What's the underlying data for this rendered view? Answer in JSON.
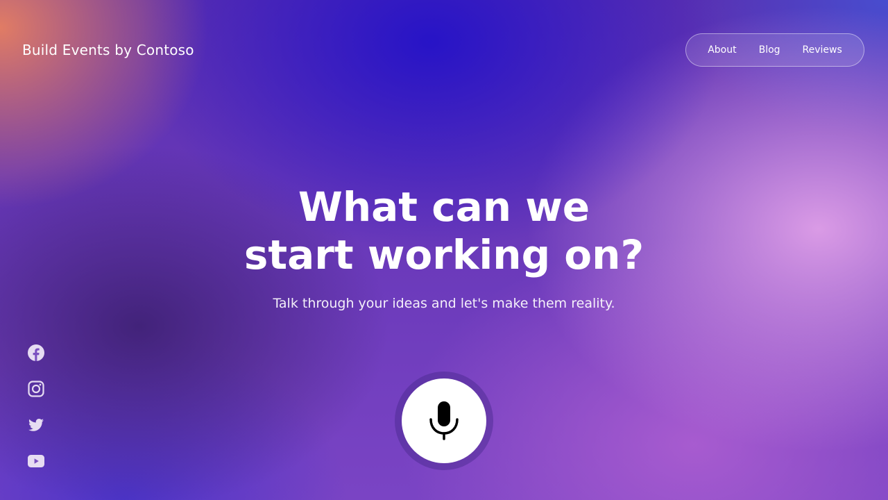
{
  "header": {
    "brand": "Build Events by Contoso"
  },
  "nav": {
    "items": [
      {
        "label": "About"
      },
      {
        "label": "Blog"
      },
      {
        "label": "Reviews"
      }
    ]
  },
  "hero": {
    "title_line1": "What can we",
    "title_line2": "start working on?",
    "subtitle": "Talk through your ideas and let's make them reality."
  },
  "social": {
    "icons": [
      "facebook-icon",
      "instagram-icon",
      "twitter-icon",
      "youtube-icon"
    ],
    "icon_color": "#e6dcf2"
  },
  "mic": {
    "icon": "microphone-icon",
    "button_color": "#ffffff",
    "icon_color": "#000000"
  },
  "colors": {
    "text": "#ffffff",
    "background_primary": "#6a3fc0",
    "background_accent_blue": "#2412c8",
    "background_accent_peach": "#e88060",
    "background_accent_pink": "#e0a0e8"
  }
}
